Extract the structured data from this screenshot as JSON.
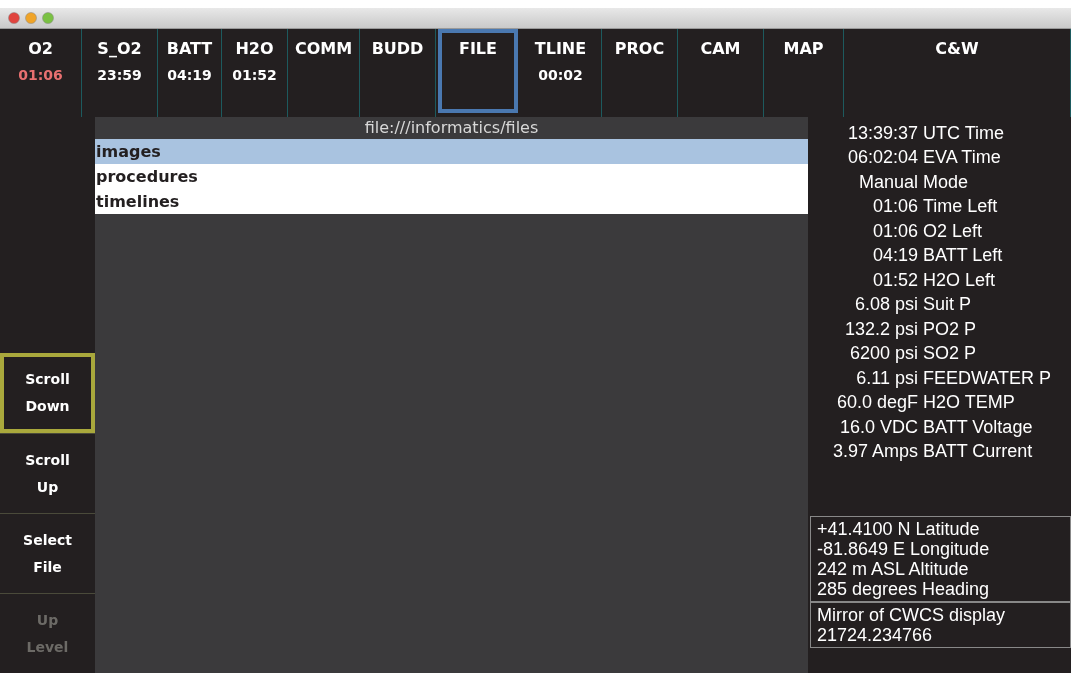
{
  "tabs": [
    {
      "label": "O2",
      "value": "01:06",
      "alert": true,
      "selected": false
    },
    {
      "label": "S_O2",
      "value": "23:59",
      "alert": false,
      "selected": false
    },
    {
      "label": "BATT",
      "value": "04:19",
      "alert": false,
      "selected": false
    },
    {
      "label": "H2O",
      "value": "01:52",
      "alert": false,
      "selected": false
    },
    {
      "label": "COMM",
      "selected": false
    },
    {
      "label": "BUDD",
      "selected": false
    },
    {
      "label": "FILE",
      "selected": true
    },
    {
      "label": "TLINE",
      "value": "00:02",
      "alert": false,
      "selected": false
    },
    {
      "label": "PROC",
      "selected": false
    },
    {
      "label": "CAM",
      "selected": false
    },
    {
      "label": "MAP",
      "selected": false
    },
    {
      "label": "C&W",
      "selected": false
    }
  ],
  "side_buttons": [
    {
      "label": "Scroll Down",
      "selected": true,
      "disabled": false
    },
    {
      "label": "Scroll Up",
      "selected": false,
      "disabled": false
    },
    {
      "label": "Select File",
      "selected": false,
      "disabled": false
    },
    {
      "label": "Up Level",
      "selected": false,
      "disabled": true
    }
  ],
  "browser": {
    "path": "file:///informatics/files",
    "items": [
      {
        "name": "images",
        "selected": true
      },
      {
        "name": "procedures",
        "selected": false
      },
      {
        "name": "timelines",
        "selected": false
      }
    ]
  },
  "readings": [
    {
      "figure": "13:39:37",
      "caption": "UTC Time"
    },
    {
      "figure": "06:02:04",
      "caption": "EVA Time"
    },
    {
      "figure": "Manual",
      "caption": "Mode"
    },
    {
      "figure": "01:06",
      "caption": "Time Left"
    },
    {
      "figure": "01:06",
      "caption": "O2 Left"
    },
    {
      "figure": "04:19",
      "caption": "BATT Left"
    },
    {
      "figure": "01:52",
      "caption": "H2O Left"
    },
    {
      "figure": "6.08 psi",
      "caption": "Suit P"
    },
    {
      "figure": "132.2 psi",
      "caption": "PO2 P"
    },
    {
      "figure": "6200 psi",
      "caption": "SO2 P"
    },
    {
      "figure": "6.11 psi",
      "caption": "FEEDWATER P"
    },
    {
      "figure": "60.0 degF",
      "caption": "H2O TEMP"
    },
    {
      "figure": "16.0 VDC",
      "caption": "BATT Voltage"
    },
    {
      "figure": "3.97 Amps",
      "caption": "BATT Current"
    }
  ],
  "position": [
    "+41.4100 N Latitude",
    "-81.8649 E Longitude",
    "242 m ASL Altitude",
    "285 degrees Heading"
  ],
  "mirror": [
    "Mirror of CWCS display",
    "21724.234766"
  ]
}
